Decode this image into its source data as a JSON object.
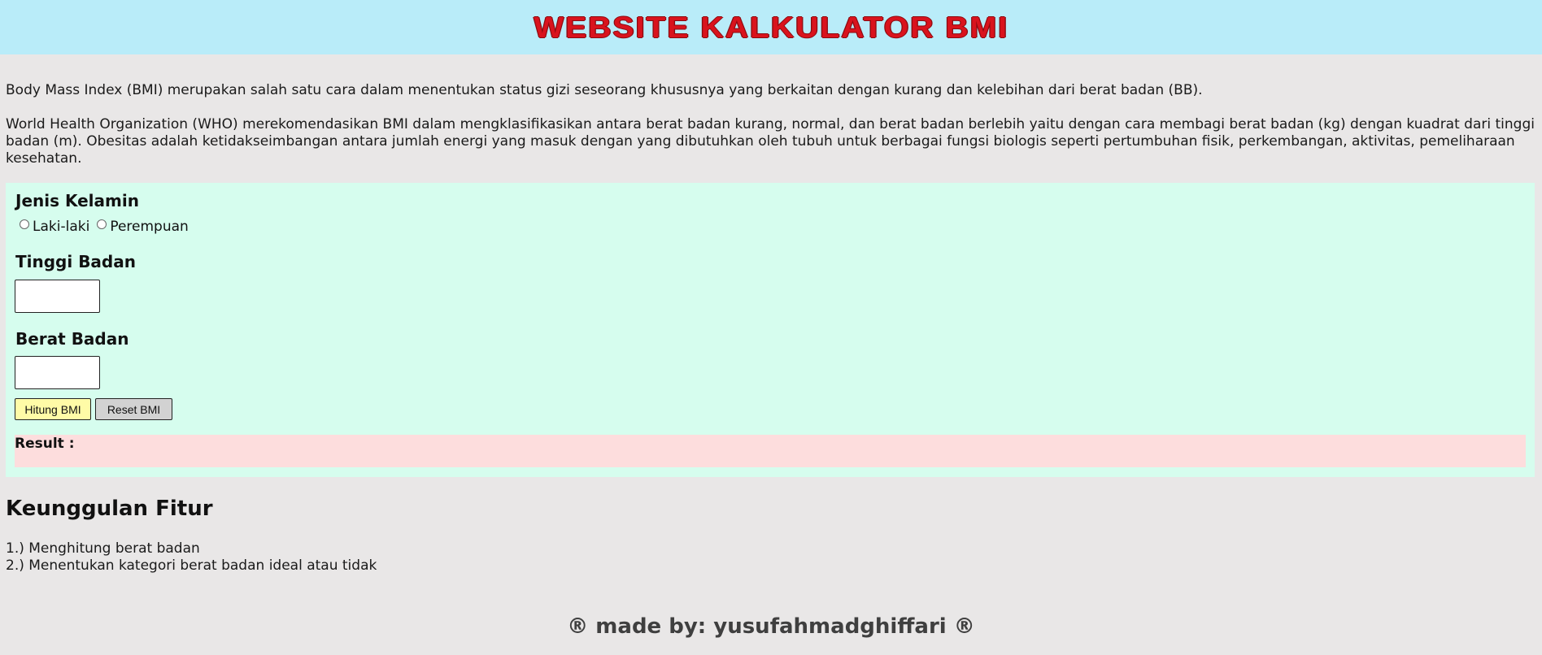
{
  "header": {
    "title": "WEBSITE KALKULATOR BMI"
  },
  "intro": {
    "paragraph1": "Body Mass Index (BMI) merupakan salah satu cara dalam menentukan status gizi seseorang khususnya yang berkaitan dengan kurang dan kelebihan dari berat badan (BB).",
    "paragraph2": "World Health Organization (WHO) merekomendasikan BMI dalam mengklasifikasikan antara berat badan kurang, normal, dan berat badan berlebih yaitu dengan cara membagi berat badan (kg) dengan kuadrat dari tinggi badan (m). Obesitas adalah ketidakseimbangan antara jumlah energi yang masuk dengan yang dibutuhkan oleh tubuh untuk berbagai fungsi biologis seperti pertumbuhan fisik, perkembangan, aktivitas, pemeliharaan kesehatan."
  },
  "form": {
    "gender_label": "Jenis Kelamin",
    "gender_options": [
      {
        "label": "Laki-laki",
        "checked": false
      },
      {
        "label": "Perempuan",
        "checked": false
      }
    ],
    "height_label": "Tinggi Badan",
    "height_value": "",
    "weight_label": "Berat Badan",
    "weight_value": "",
    "calculate_label": "Hitung BMI",
    "reset_label": "Reset BMI",
    "result_label": "Result :"
  },
  "features": {
    "title": "Keunggulan Fitur",
    "items": [
      "1.) Menghitung berat badan",
      "2.) Menentukan kategori berat badan ideal atau tidak"
    ]
  },
  "footer": {
    "text": "® made by: yusufahmadghiffari ®"
  },
  "colors": {
    "header_bg": "#b9ecf9",
    "title_red": "#d9131d",
    "page_bg": "#e9e7e7",
    "form_bg": "#d6fdee",
    "result_bg": "#fddddd",
    "calculate_bg": "#fffba7",
    "reset_bg": "#d2d2d2"
  }
}
